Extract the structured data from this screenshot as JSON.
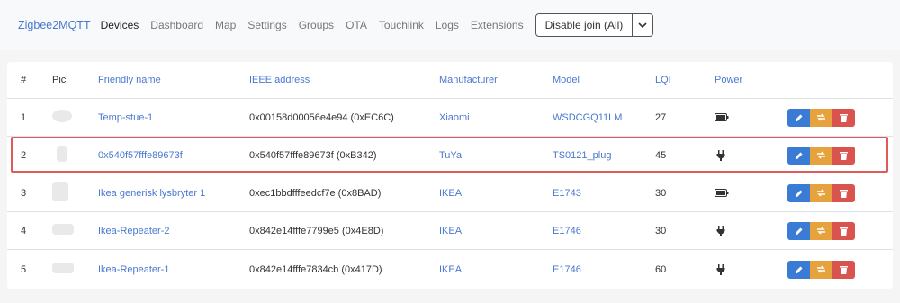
{
  "nav": {
    "brand": "Zigbee2MQTT",
    "links": [
      "Devices",
      "Dashboard",
      "Map",
      "Settings",
      "Groups",
      "OTA",
      "Touchlink",
      "Logs",
      "Extensions"
    ],
    "join_button": "Disable join (All)"
  },
  "table": {
    "headers": {
      "index": "#",
      "pic": "Pic",
      "friendly_name": "Friendly name",
      "ieee": "IEEE address",
      "manufacturer": "Manufacturer",
      "model": "Model",
      "lqi": "LQI",
      "power": "Power"
    },
    "rows": [
      {
        "index": "1",
        "friendly_name": "Temp-stue-1",
        "ieee": "0x00158d00056e4e94 (0xEC6C)",
        "manufacturer": "Xiaomi",
        "model": "WSDCGQ11LM",
        "lqi": "27",
        "power": "battery"
      },
      {
        "index": "2",
        "friendly_name": "0x540f57fffe89673f",
        "ieee": "0x540f57fffe89673f (0xB342)",
        "manufacturer": "TuYa",
        "model": "TS0121_plug",
        "lqi": "45",
        "power": "plug"
      },
      {
        "index": "3",
        "friendly_name": "Ikea generisk lysbryter 1",
        "ieee": "0xec1bbdfffeedcf7e (0x8BAD)",
        "manufacturer": "IKEA",
        "model": "E1743",
        "lqi": "30",
        "power": "battery"
      },
      {
        "index": "4",
        "friendly_name": "Ikea-Repeater-2",
        "ieee": "0x842e14fffe7799e5 (0x4E8D)",
        "manufacturer": "IKEA",
        "model": "E1746",
        "lqi": "30",
        "power": "plug"
      },
      {
        "index": "5",
        "friendly_name": "Ikea-Repeater-1",
        "ieee": "0x842e14fffe7834cb (0x417D)",
        "manufacturer": "IKEA",
        "model": "E1746",
        "lqi": "60",
        "power": "plug"
      }
    ]
  },
  "colors": {
    "link": "#4a78d0",
    "edit": "#3a7bd5",
    "rename": "#e6a23c",
    "remove": "#d9534f",
    "highlight": "#e05a5a"
  }
}
